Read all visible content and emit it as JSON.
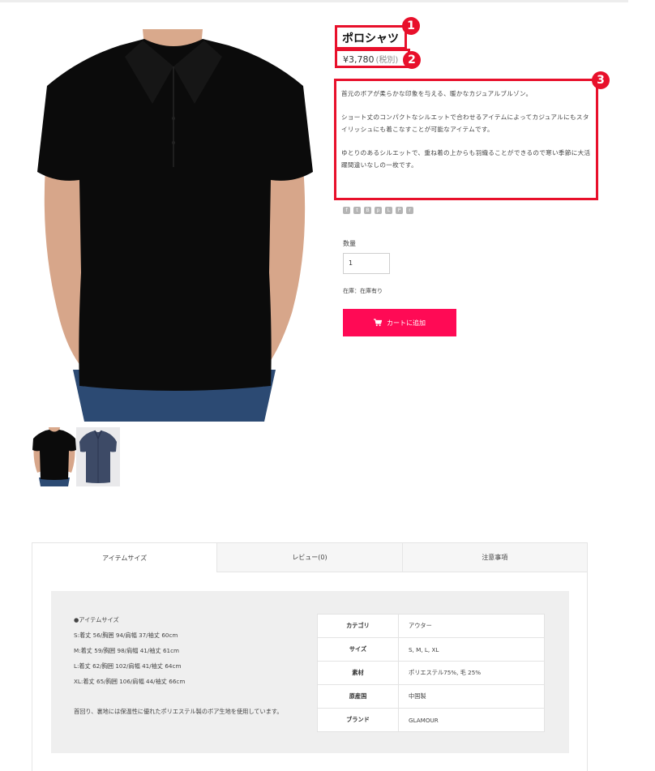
{
  "product": {
    "title": "ポロシャツ",
    "price": "¥3,780",
    "tax_note": "(税別)",
    "description": [
      "首元のボアが柔らかな印象を与える、暖かなカジュアルブルゾン。",
      "ショート丈のコンパクトなシルエットで合わせるアイテムによってカジュアルにもスタイリッシュにも着こなすことが可能なアイテムです。",
      "ゆとりのあるシルエットで、重ね着の上からも羽織ることができるので寒い季節に大活躍間違いなしの一枚です。"
    ]
  },
  "annotations": {
    "badge1": "1",
    "badge2": "2",
    "badge3": "3"
  },
  "share_icons": [
    "facebook-icon",
    "twitter-icon",
    "hatena-icon",
    "pocket-icon",
    "line-icon",
    "pinterest-icon",
    "rss-icon"
  ],
  "purchase": {
    "qty_label": "数量",
    "qty_value": "1",
    "stock_text": "在庫：在庫有り",
    "cart_label": "カートに追加"
  },
  "tabs": [
    {
      "label": "アイテムサイズ",
      "active": true
    },
    {
      "label": "レビュー(0)",
      "active": false
    },
    {
      "label": "注意事項",
      "active": false
    }
  ],
  "size_info": {
    "heading": "●アイテムサイズ",
    "lines": [
      "S:着丈 56/胸囲 94/肩幅 37/袖丈 60cm",
      "M:着丈 59/胸囲 98/肩幅 41/袖丈 61cm",
      "L:着丈 62/胸囲 102/肩幅 41/袖丈 64cm",
      "XL:着丈 65/胸囲 106/肩幅 44/袖丈 66cm"
    ],
    "note": "首回り、裏地には保温性に優れたポリエステル製のボア生地を使用しています。"
  },
  "spec_table": [
    {
      "key": "カテゴリ",
      "value": "アウター"
    },
    {
      "key": "サイズ",
      "value": "S, M, L, XL"
    },
    {
      "key": "素材",
      "value": "ポリエステル75%, 毛 25%"
    },
    {
      "key": "原産国",
      "value": "中国製"
    },
    {
      "key": "ブランド",
      "value": "GLAMOUR"
    }
  ],
  "colors": {
    "accent": "#e8102b",
    "cart": "#ff0a55"
  }
}
